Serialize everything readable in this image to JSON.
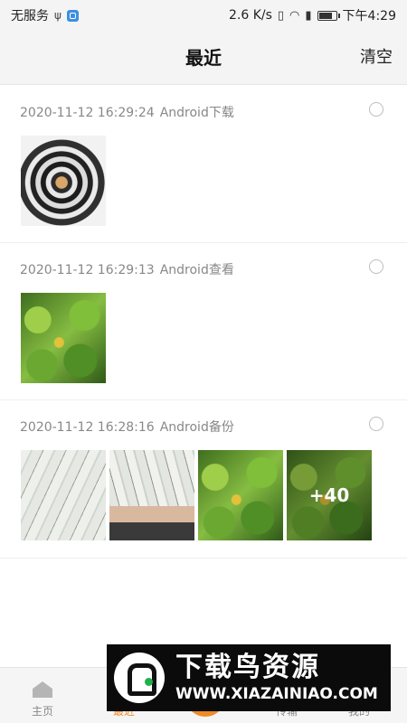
{
  "status_bar": {
    "carrier": "无服务",
    "usb_icon": "usb-icon",
    "network_speed": "2.6 K/s",
    "time": "下午4:29",
    "icons": [
      "vibrate-icon",
      "wifi-icon",
      "sim-icon",
      "battery-icon"
    ]
  },
  "header": {
    "title": "最近",
    "clear_label": "清空"
  },
  "groups": [
    {
      "timestamp": "2020-11-12 16:29:24",
      "source": "Android下载",
      "photos": [
        "spiral-staircase-photo"
      ]
    },
    {
      "timestamp": "2020-11-12 16:29:13",
      "source": "Android查看",
      "photos": [
        "green-leaves-photo"
      ]
    },
    {
      "timestamp": "2020-11-12 16:28:16",
      "source": "Android备份",
      "photos": [
        "banknotes-photo",
        "banknotes-hand-photo",
        "green-leaves-photo",
        "green-leaves-photo"
      ],
      "more_label": "+40"
    }
  ],
  "tab_bar": {
    "home": "主页",
    "recent": "最近",
    "transfer": "传输",
    "mine": "我的",
    "accent_color": "#f08a24"
  },
  "watermark": {
    "name": "下载鸟资源",
    "url": "WWW.XIAZAINIAO.COM"
  }
}
